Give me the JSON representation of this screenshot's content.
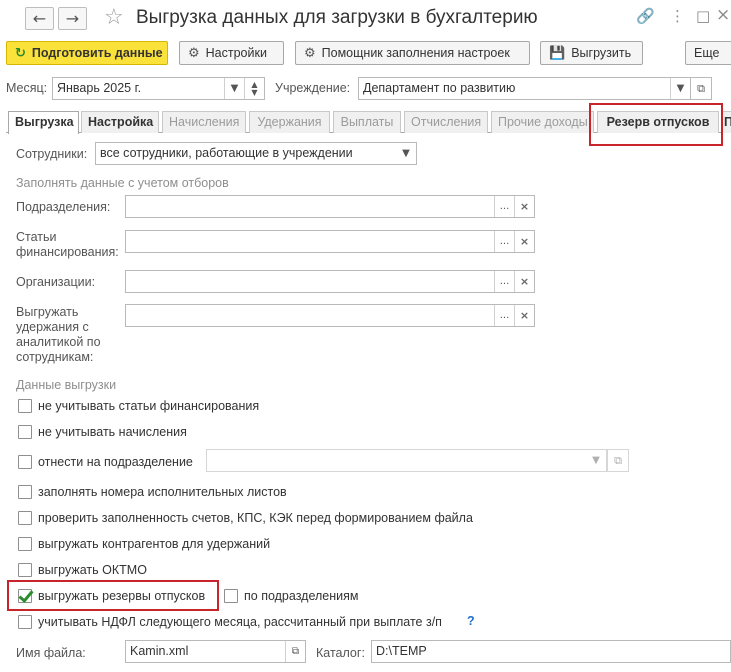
{
  "window": {
    "title": "Выгрузка данных для загрузки в бухгалтерию",
    "back_icon": "arrow-left-icon",
    "forward_icon": "arrow-right-icon",
    "favorite_icon": "star-icon"
  },
  "toolbar": {
    "prepare_label": "Подготовить данные",
    "settings_label": "Настройки",
    "wizard_label": "Помощник заполнения настроек",
    "export_label": "Выгрузить",
    "more_label": "Еще"
  },
  "header": {
    "month_label": "Месяц:",
    "month_value": "Январь 2025 г.",
    "org_label": "Учреждение:",
    "org_value": "Департамент по развитию"
  },
  "tabs": [
    {
      "label": "Выгрузка"
    },
    {
      "label": "Настройка"
    },
    {
      "label": "Начисления"
    },
    {
      "label": "Удержания"
    },
    {
      "label": "Выплаты"
    },
    {
      "label": "Отчисления"
    },
    {
      "label": "Прочие доходы"
    },
    {
      "label": "Резерв отпусков"
    },
    {
      "label": "П"
    }
  ],
  "filters": {
    "employees_label": "Сотрудники:",
    "employees_value": "все сотрудники, работающие в учреждении",
    "section_title": "Заполнять данные с учетом отборов",
    "departments_label": "Подразделения:",
    "finance_label": "Статьи финансирования:",
    "orgs_label": "Организации:",
    "deductions_label": "Выгружать удержания с аналитикой по сотрудникам:"
  },
  "export": {
    "section_title": "Данные выгрузки",
    "options": [
      {
        "label": "не учитывать статьи финансирования",
        "checked": false
      },
      {
        "label": "не учитывать начисления",
        "checked": false
      },
      {
        "label": "отнести на подразделение",
        "checked": false
      },
      {
        "label": "заполнять номера исполнительных листов",
        "checked": false
      },
      {
        "label": "проверить заполненность счетов, КПС, КЭК перед формированием файла",
        "checked": false
      },
      {
        "label": "выгружать контрагентов для удержаний",
        "checked": false
      },
      {
        "label": "выгружать ОКТМО",
        "checked": false
      },
      {
        "label": "выгружать резервы отпусков",
        "checked": true
      },
      {
        "label": "по подразделениям",
        "checked": false
      },
      {
        "label": "учитывать НДФЛ следующего месяца, рассчитанный при выплате з/п",
        "checked": false
      }
    ],
    "help_mark": "?"
  },
  "file": {
    "name_label": "Имя файла:",
    "name_value": "Kamin.xml",
    "dir_label": "Каталог:",
    "dir_value": "D:\\TEMP"
  },
  "colors": {
    "primary_button": "#fbe23a",
    "highlight": "#c8242b",
    "check": "#2e8b2e"
  }
}
